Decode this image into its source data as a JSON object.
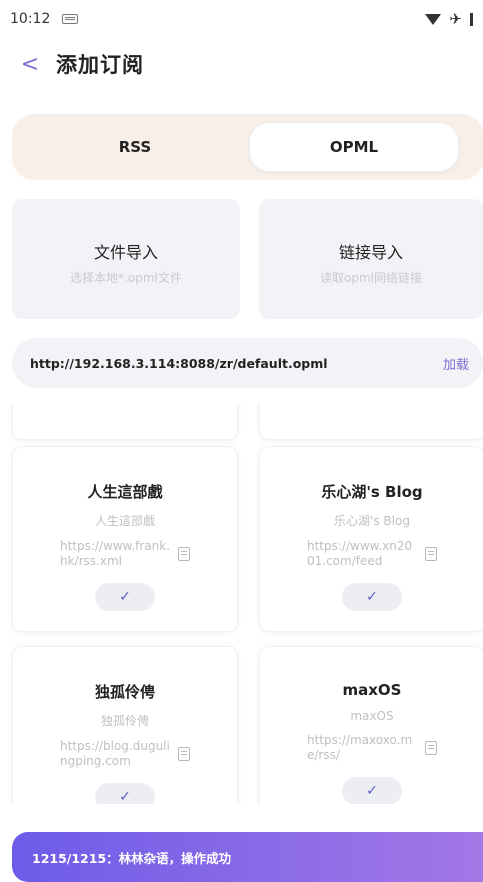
{
  "status_bar": {
    "time": "10:12"
  },
  "header": {
    "title": "添加订阅",
    "back": "<"
  },
  "tabs": [
    {
      "label": "RSS"
    },
    {
      "label": "OPML"
    }
  ],
  "import": {
    "file": {
      "title": "文件导入",
      "subtitle": "选择本地*.opml文件"
    },
    "link": {
      "title": "链接导入",
      "subtitle": "读取opml网络链接"
    }
  },
  "url_bar": {
    "value": "http://192.168.3.114:8088/zr/default.opml",
    "load_label": "加载"
  },
  "feeds": [
    {
      "title": "人生這部戲",
      "subtitle": "人生這部戲",
      "url": "https://www.frank.hk/rss.xml",
      "check": "✓"
    },
    {
      "title": "乐心湖's Blog",
      "subtitle": "乐心湖's Blog",
      "url": "https://www.xn2001.com/feed",
      "check": "✓"
    },
    {
      "title": "独孤伶俜",
      "subtitle": "独孤伶俜",
      "url": "https://blog.dugulingping.com",
      "check": "✓"
    },
    {
      "title": "maxOS",
      "subtitle": "maxOS",
      "url": "https://maxoxo.me/rss/",
      "check": "✓"
    }
  ],
  "toast": {
    "message": "1215/1215：林林杂语，操作成功"
  }
}
